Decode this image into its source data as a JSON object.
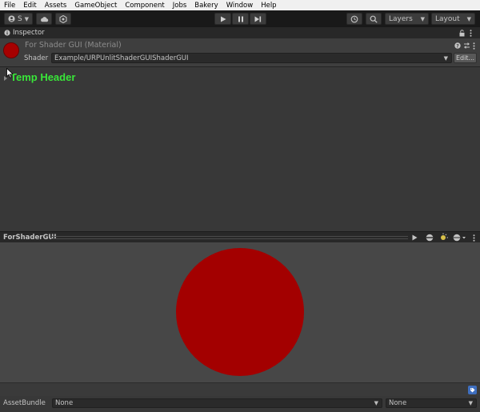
{
  "menu": [
    "File",
    "Edit",
    "Assets",
    "GameObject",
    "Component",
    "Jobs",
    "Bakery",
    "Window",
    "Help"
  ],
  "toolbar": {
    "account_label": "S",
    "layers_label": "Layers",
    "layout_label": "Layout"
  },
  "inspector": {
    "tab_label": "Inspector",
    "material_title": "For Shader GUI (Material)",
    "shader_label": "Shader",
    "shader_value": "Example/URPUnlitShaderGUIShaderGUI",
    "edit_label": "Edit...",
    "temp_header": "Temp Header"
  },
  "preview": {
    "title": "ForShaderGUI",
    "sphere_color": "#a30000"
  },
  "asset_bundle": {
    "label": "AssetBundle",
    "name_value": "None",
    "variant_value": "None"
  },
  "colors": {
    "accent_green": "#39e639",
    "material_red": "#a60000"
  }
}
